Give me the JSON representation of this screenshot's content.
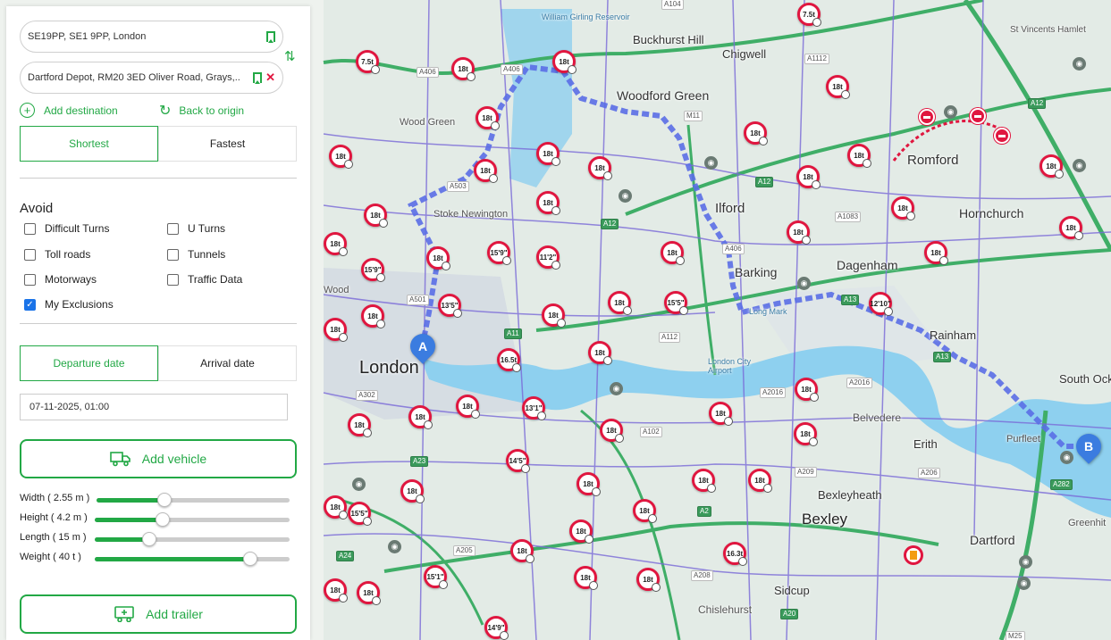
{
  "route": {
    "origin": "SE19PP, SE1 9PP, London",
    "destination": "Dartford Depot, RM20 3ED Oliver Road, Grays,..",
    "add_destination": "Add destination",
    "back_to_origin": "Back to origin"
  },
  "route_mode": {
    "shortest": "Shortest",
    "fastest": "Fastest",
    "selected": "Shortest"
  },
  "avoid": {
    "title": "Avoid",
    "options": [
      {
        "label": "Difficult Turns",
        "checked": false
      },
      {
        "label": "U Turns",
        "checked": false
      },
      {
        "label": "Toll roads",
        "checked": false
      },
      {
        "label": "Tunnels",
        "checked": false
      },
      {
        "label": "Motorways",
        "checked": false
      },
      {
        "label": "Traffic Data",
        "checked": false
      },
      {
        "label": "My Exclusions",
        "checked": true
      }
    ]
  },
  "timing": {
    "departure": "Departure date",
    "arrival": "Arrival date",
    "selected": "Departure date",
    "datetime": "07-11-2025, 01:00"
  },
  "vehicle": {
    "add_vehicle": "Add vehicle",
    "add_trailer": "Add trailer",
    "dimensions": [
      {
        "label": "Width ( 2.55 m )",
        "fraction": 0.35
      },
      {
        "label": "Height ( 4.2 m )",
        "fraction": 0.35
      },
      {
        "label": "Length ( 15 m )",
        "fraction": 0.28
      },
      {
        "label": "Weight ( 40 t )",
        "fraction": 0.8
      }
    ]
  },
  "map": {
    "places": [
      "William Girling Reservoir",
      "Buckhurst Hill",
      "Chigwell",
      "St Vincents Hamlet",
      "Woodford Green",
      "Wood Green",
      "Romford",
      "Stoke Newington",
      "Ilford",
      "Hornchurch",
      "Barking",
      "Dagenham",
      "Wood",
      "Rainham",
      "London",
      "London City Airport",
      "South Ock",
      "Belvedere",
      "Purfleet",
      "Erith",
      "Bexleyheath",
      "Bexley",
      "Greenhit",
      "Dartford",
      "Sidcup",
      "Chislehurst",
      "Long Mark"
    ],
    "road_labels": [
      "A104",
      "A1112",
      "A406",
      "A406",
      "M11",
      "A12",
      "A503",
      "A12",
      "A1083",
      "A12",
      "A406",
      "A501",
      "A11",
      "A13",
      "A112",
      "A13",
      "A302",
      "A2016",
      "A2016",
      "A102",
      "A23",
      "A209",
      "A206",
      "A282",
      "A2",
      "A24",
      "A205",
      "A208",
      "A20",
      "M25"
    ],
    "restrictions": [
      "7.5t",
      "7.5t",
      "18t",
      "18t",
      "18t",
      "18t",
      "18t",
      "18t",
      "18t",
      "18t",
      "18t",
      "18t",
      "18t",
      "18t",
      "18t",
      "18t",
      "18t",
      "18t",
      "18t",
      "15'9\"",
      "11'2\"",
      "18t",
      "18t",
      "18t",
      "15'9\"",
      "13'5\"",
      "15'5\"",
      "18t",
      "18t",
      "18t",
      "12'10\"",
      "18t",
      "16.5t",
      "18t",
      "18t",
      "13'1\"",
      "18t",
      "18t",
      "18t",
      "18t",
      "18t",
      "14'5\"",
      "18t",
      "18t",
      "18t",
      "18t",
      "18t",
      "15'5\"",
      "18t",
      "18t",
      "16.3t",
      "18t",
      "18t",
      "15'1\"",
      "18t",
      "14'9\"",
      "18t",
      "18t",
      "18t",
      "18t"
    ],
    "markers": {
      "start": "A",
      "end": "B"
    },
    "colors": {
      "route": "#5a6ee6",
      "restriction": "#e0163f",
      "water": "#8ed0ef",
      "accent": "#22a845"
    }
  }
}
